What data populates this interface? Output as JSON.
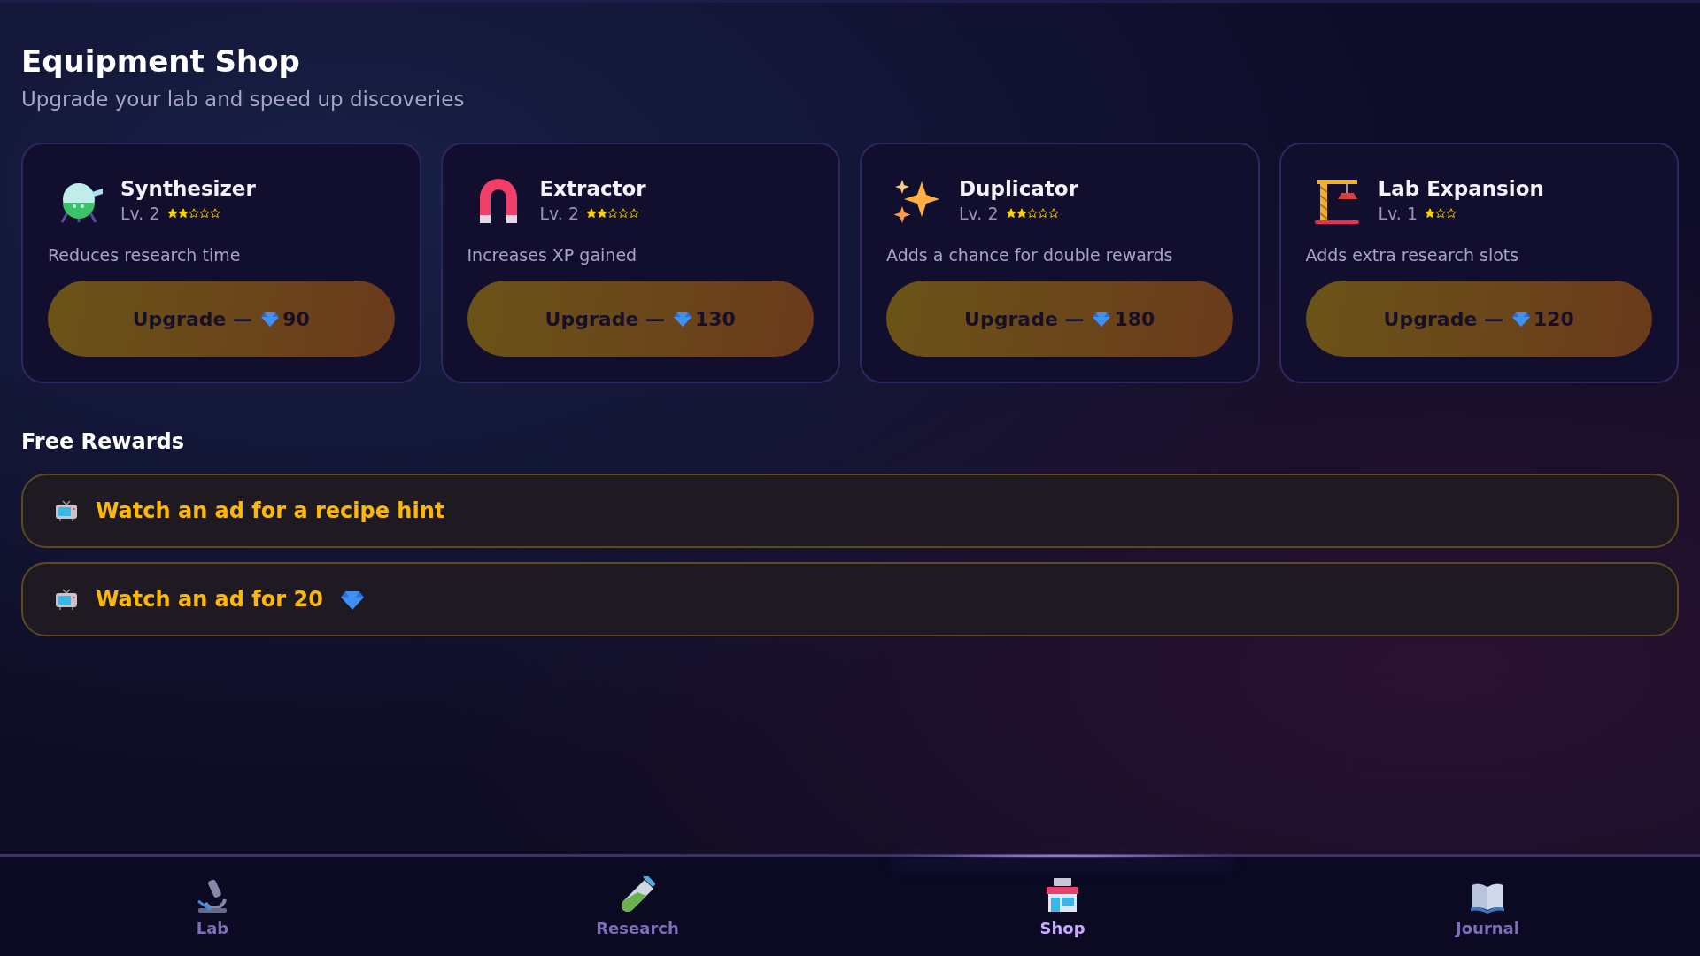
{
  "header": {
    "title": "Equipment Shop",
    "subtitle": "Upgrade your lab and speed up discoveries"
  },
  "items": [
    {
      "kind": "synthesizer",
      "name": "Synthesizer",
      "level": "Lv. 2",
      "star_slots": [
        {
          "filled": true
        },
        {
          "filled": true
        },
        {
          "filled": false
        },
        {
          "filled": false
        },
        {
          "filled": false
        }
      ],
      "description": "Reduces research time",
      "button": "Upgrade —",
      "price": "90"
    },
    {
      "kind": "magnet",
      "name": "Extractor",
      "level": "Lv. 2",
      "star_slots": [
        {
          "filled": true
        },
        {
          "filled": true
        },
        {
          "filled": false
        },
        {
          "filled": false
        },
        {
          "filled": false
        }
      ],
      "description": "Increases XP gained",
      "button": "Upgrade —",
      "price": "130"
    },
    {
      "kind": "sparkles",
      "name": "Duplicator",
      "level": "Lv. 2",
      "star_slots": [
        {
          "filled": true
        },
        {
          "filled": true
        },
        {
          "filled": false
        },
        {
          "filled": false
        },
        {
          "filled": false
        }
      ],
      "description": "Adds a chance for double rewards",
      "button": "Upgrade —",
      "price": "180"
    },
    {
      "kind": "crane",
      "name": "Lab Expansion",
      "level": "Lv. 1",
      "star_slots": [
        {
          "filled": true
        },
        {
          "filled": false
        },
        {
          "filled": false
        }
      ],
      "description": "Adds extra research slots",
      "button": "Upgrade —",
      "price": "120"
    }
  ],
  "free_rewards": {
    "title": "Free Rewards",
    "items": [
      {
        "label": "Watch an ad for a recipe hint",
        "gem": false
      },
      {
        "label": "Watch an ad for 20",
        "gem": true
      }
    ]
  },
  "nav": [
    {
      "kind": "lab",
      "label": "Lab",
      "selected": false
    },
    {
      "kind": "research",
      "label": "Research",
      "selected": false
    },
    {
      "kind": "shop",
      "label": "Shop",
      "selected": true
    },
    {
      "kind": "journal",
      "label": "Journal",
      "selected": false
    }
  ]
}
